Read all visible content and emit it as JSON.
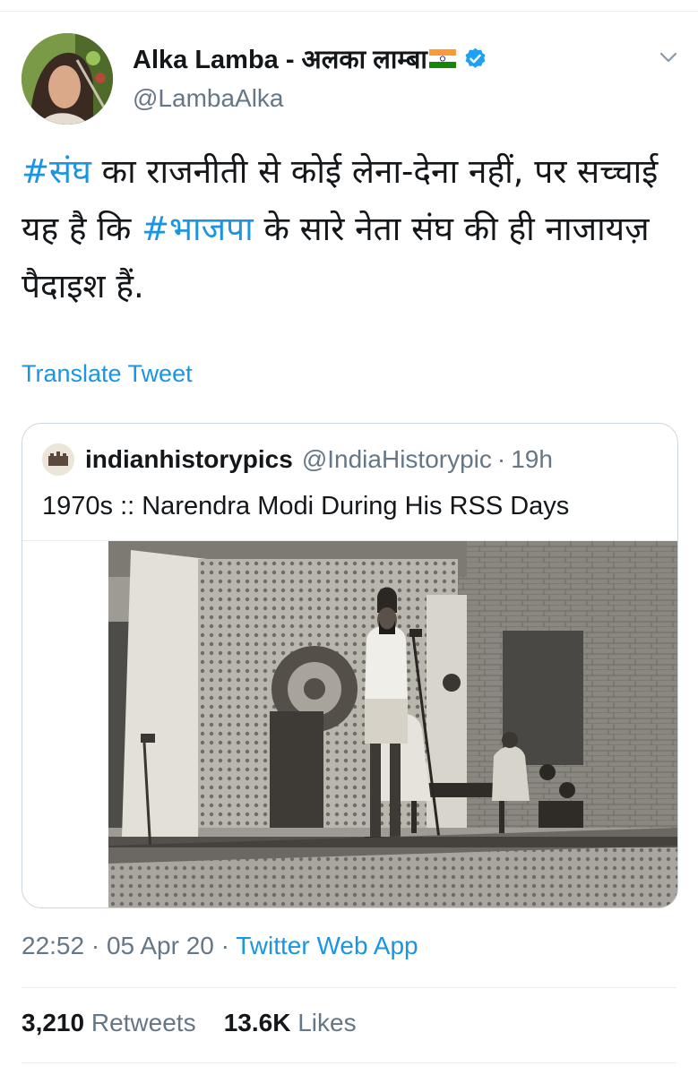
{
  "author": {
    "display_name": "Alka Lamba - अलका लाम्बा",
    "handle": "@LambaAlka",
    "flag_icon": "india-flag-icon",
    "verified_icon": "verified-badge-icon"
  },
  "tweet": {
    "segments": [
      {
        "text": "#संघ",
        "hashtag": true
      },
      {
        "text": " का राजनीती से कोई लेना-देना नहीं, पर सच्चाई यह है कि ",
        "hashtag": false
      },
      {
        "text": "#भाजपा",
        "hashtag": true
      },
      {
        "text": " के सारे नेता संघ की ही नाजायज़ पैदाइश हैं.",
        "hashtag": false
      }
    ],
    "translate_label": "Translate Tweet"
  },
  "quote": {
    "name": "indianhistorypics",
    "handle": "@IndiaHistorypic",
    "separator": "·",
    "time": "19h",
    "text": "1970s :: Narendra Modi During His RSS Days"
  },
  "meta": {
    "time": "22:52",
    "date": "05 Apr 20",
    "separator": "·",
    "app": "Twitter Web App"
  },
  "stats": {
    "retweets_count": "3,210",
    "retweets_label": "Retweets",
    "likes_count": "13.6K",
    "likes_label": "Likes"
  },
  "colors": {
    "link": "#1b95e0",
    "secondary_text": "#657786",
    "primary_text": "#14171a",
    "verified": "#1da1f2"
  }
}
